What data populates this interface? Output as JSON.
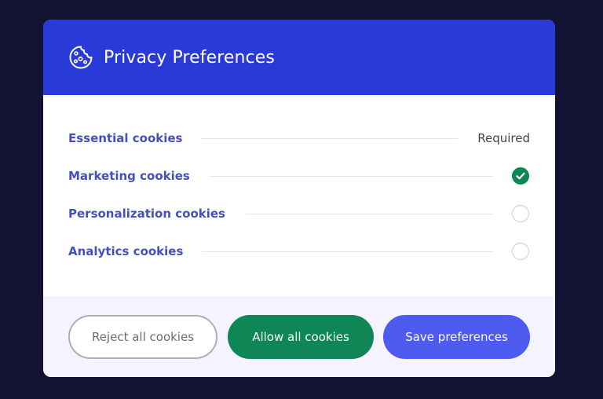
{
  "dialog": {
    "title": "Privacy Preferences",
    "icon": "cookie-icon"
  },
  "cookies": [
    {
      "label": "Essential cookies",
      "status": "Required"
    },
    {
      "label": "Marketing cookies",
      "checked": true
    },
    {
      "label": "Personalization cookies",
      "checked": false
    },
    {
      "label": "Analytics cookies",
      "checked": false
    }
  ],
  "buttons": {
    "reject": "Reject all cookies",
    "allow": "Allow all cookies",
    "save": "Save preferences"
  },
  "colors": {
    "header": "#2a3ad9",
    "label": "#4550b8",
    "green": "#0e8656",
    "save": "#4d5bf0"
  }
}
